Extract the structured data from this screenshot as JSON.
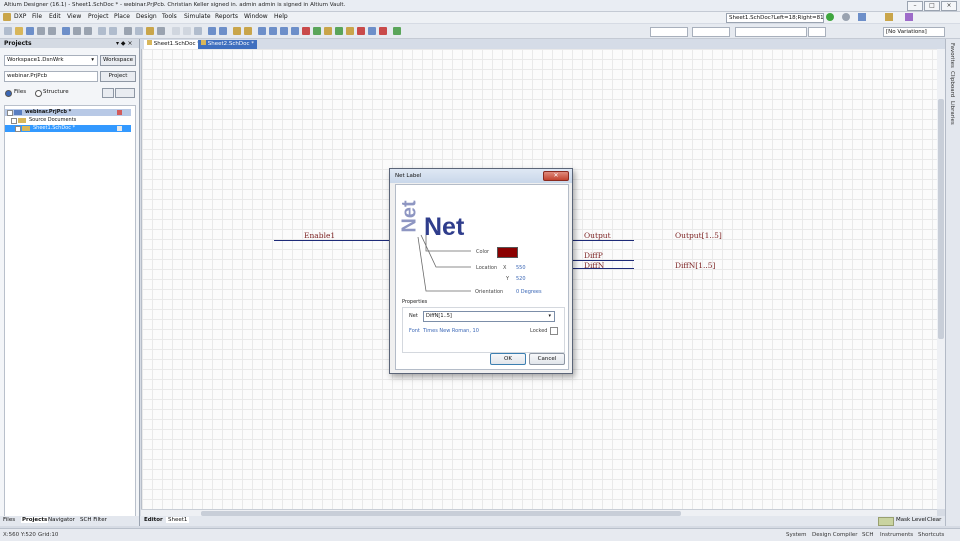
{
  "window": {
    "title": "Altium Designer (16.1) - Sheet1.SchDoc * - webinar.PrjPcb. Christian Keller signed in. admin admin is signed in Altium Vault."
  },
  "menu": [
    "DXP",
    "File",
    "Edit",
    "View",
    "Project",
    "Place",
    "Design",
    "Tools",
    "Simulate",
    "Reports",
    "Window",
    "Help"
  ],
  "toolbar": {
    "doc_status": "Sheet1.SchDoc?Left=18;Right=811;",
    "variations": "[No Variations]"
  },
  "panel": {
    "title": "Projects",
    "workspace_field": "Workspace1.DsnWrk",
    "workspace_button": "Workspace",
    "project_field": "webinar.PrjPcb",
    "project_button": "Project",
    "view_files": "Files",
    "view_structure": "Structure",
    "tree": {
      "project": "webinar.PrjPcb *",
      "folder": "Source Documents",
      "document": "Sheet1.SchDoc *"
    },
    "tabs": [
      "Files",
      "Projects",
      "Navigator",
      "SCH Filter"
    ]
  },
  "doc_tabs": [
    "Sheet1.SchDoc *",
    "Sheet2.SchDoc *"
  ],
  "schematic": {
    "labels": {
      "enable": "Enable1",
      "output": "Output",
      "output_bus": "Output[1..5]",
      "diffp": "DiffP",
      "diffn": "DiffN",
      "diffn_bus": "DiffN[1..5]"
    }
  },
  "right_strip": [
    "Favorites",
    "Clipboard",
    "Libraries"
  ],
  "editor_tabs": [
    "Editor",
    "Sheet1"
  ],
  "mask": {
    "level": "Mask Level",
    "clear": "Clear"
  },
  "status": {
    "coords": "X:560 Y:520",
    "grid": "Grid:10",
    "items": [
      "System",
      "Design Compiler",
      "SCH",
      "Instruments",
      "Shortcuts"
    ]
  },
  "dialog": {
    "title": "Net Label",
    "preview_big": "Net",
    "preview_rotated": "Net",
    "color_label": "Color",
    "color_value": "#8b0000",
    "location_label": "Location",
    "x_label": "X",
    "x_value": "550",
    "y_label": "Y",
    "y_value": "520",
    "orientation_label": "Orientation",
    "orientation_value": "0 Degrees",
    "properties_header": "Properties",
    "net_label": "Net",
    "net_value": "DiffN[1..5]",
    "font_label": "Font",
    "font_value": "Times New Roman, 10",
    "locked_label": "Locked",
    "ok": "OK",
    "cancel": "Cancel"
  }
}
